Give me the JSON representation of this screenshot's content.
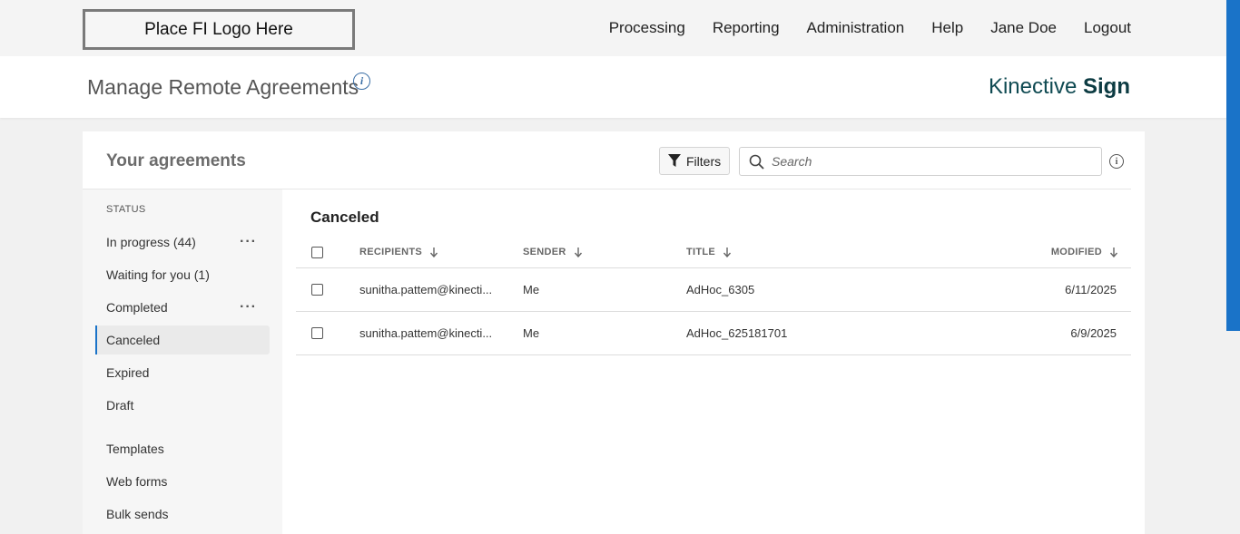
{
  "header": {
    "logo_text": "Place FI Logo Here",
    "nav": [
      "Processing",
      "Reporting",
      "Administration",
      "Help",
      "Jane Doe",
      "Logout"
    ]
  },
  "subheader": {
    "title": "Manage Remote Agreements",
    "info_glyph": "i",
    "brand_light": "Kinective",
    "brand_bold": "Sign"
  },
  "card": {
    "title": "Your agreements",
    "filters_label": "Filters",
    "search_placeholder": "Search",
    "info_glyph": "i"
  },
  "sidebar": {
    "status_label": "STATUS",
    "status_items": [
      {
        "label": "In progress (44)",
        "has_menu": true
      },
      {
        "label": "Waiting for you (1)",
        "has_menu": false
      },
      {
        "label": "Completed",
        "has_menu": true
      },
      {
        "label": "Canceled",
        "has_menu": false,
        "active": true
      },
      {
        "label": "Expired",
        "has_menu": false
      },
      {
        "label": "Draft",
        "has_menu": false
      }
    ],
    "other_items": [
      "Templates",
      "Web forms",
      "Bulk sends"
    ],
    "menu_glyph": "···"
  },
  "main": {
    "section_title": "Canceled",
    "columns": [
      "RECIPIENTS",
      "SENDER",
      "TITLE",
      "MODIFIED"
    ],
    "rows": [
      {
        "recipient": "sunitha.pattem@kinecti...",
        "sender": "Me",
        "title": "AdHoc_6305",
        "modified": "6/11/2025"
      },
      {
        "recipient": "sunitha.pattem@kinecti...",
        "sender": "Me",
        "title": "AdHoc_625181701",
        "modified": "6/9/2025"
      }
    ]
  },
  "colors": {
    "accent": "#1a73c8",
    "brand": "#0f4a52"
  }
}
